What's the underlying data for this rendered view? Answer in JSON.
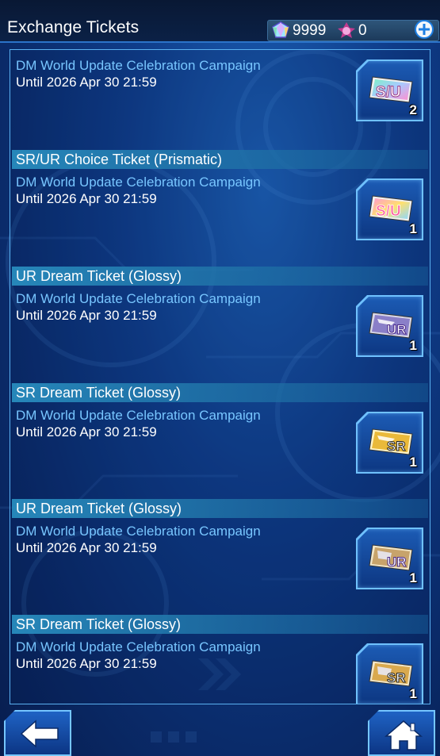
{
  "header": {
    "title": "Exchange Tickets",
    "gems": "9999",
    "orbs": "0"
  },
  "tickets": [
    {
      "name": "",
      "campaign": "DM World Update Celebration Campaign",
      "until": "Until 2026 Apr 30 21:59",
      "badge": "S/U",
      "quantity": "2",
      "icon": "su-prismatic-ticket-icon"
    },
    {
      "name": "SR/UR Choice Ticket (Prismatic)",
      "campaign": "DM World Update Celebration Campaign",
      "until": "Until 2026 Apr 30 21:59",
      "badge": "S/U",
      "quantity": "1",
      "icon": "su-choice-ticket-icon"
    },
    {
      "name": "UR Dream Ticket (Glossy)",
      "campaign": "DM World Update Celebration Campaign",
      "until": "Until 2026 Apr 30 21:59",
      "badge": "UR",
      "quantity": "1",
      "icon": "ur-dream-ticket-icon"
    },
    {
      "name": "SR Dream Ticket (Glossy)",
      "campaign": "DM World Update Celebration Campaign",
      "until": "Until 2026 Apr 30 21:59",
      "badge": "SR",
      "quantity": "1",
      "icon": "sr-dream-ticket-icon"
    },
    {
      "name": "UR Dream Ticket (Glossy)",
      "campaign": "DM World Update Celebration Campaign",
      "until": "Until 2026 Apr 30 21:59",
      "badge": "UR",
      "quantity": "1",
      "icon": "ur-dream-ticket-icon"
    },
    {
      "name": "SR Dream Ticket (Glossy)",
      "campaign": "DM World Update Celebration Campaign",
      "until": "Until 2026 Apr 30 21:59",
      "badge": "SR",
      "quantity": "1",
      "icon": "sr-dream-ticket-icon"
    }
  ],
  "colors": {
    "campaign_text": "#78c6ff",
    "accent_border": "#6fc1ff",
    "su_ticket": "#ff5fa0",
    "ur_ticket": "#b98ee0",
    "sr_ticket": "#f2c94c"
  }
}
